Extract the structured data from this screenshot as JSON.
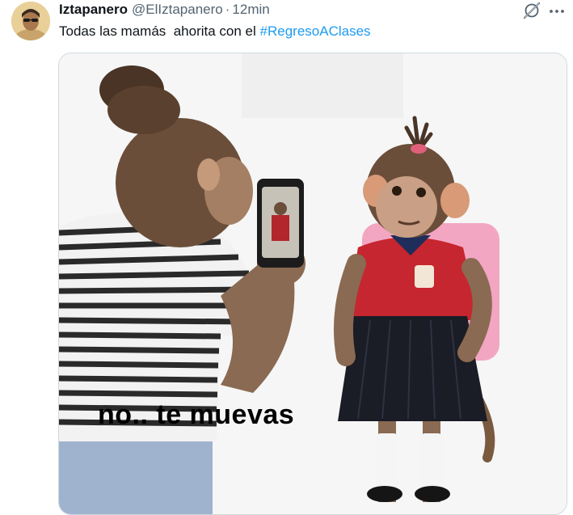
{
  "tweet": {
    "author": {
      "display_name": "Iztapanero",
      "handle": "@ElIztapanero",
      "avatar_icon": "user-avatar"
    },
    "separator": "·",
    "time": "12min",
    "text_before": "Todas las mamás  ahorita con el ",
    "hashtag": "#RegresoAClases",
    "media": {
      "caption": "no.. te muevas"
    },
    "actions": {
      "grok_icon": "grok-icon",
      "more_icon": "more-icon"
    },
    "colors": {
      "text": "#0f1419",
      "secondary": "#536471",
      "link": "#1d9bf0",
      "border": "#cfd9de"
    }
  }
}
